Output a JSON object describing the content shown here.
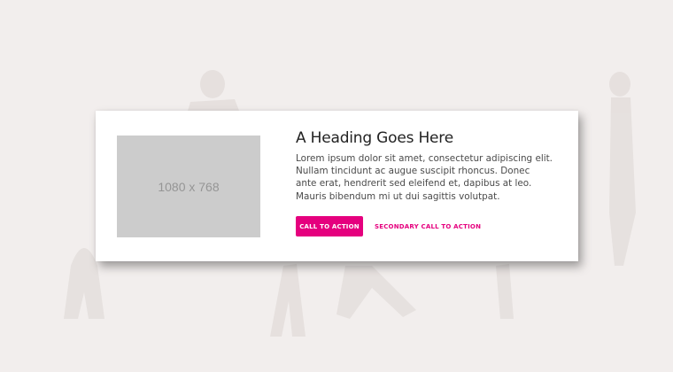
{
  "card": {
    "image_placeholder": "1080 x 768",
    "heading": "A Heading Goes Here",
    "body": "Lorem ipsum dolor sit amet, consectetur adipiscing elit. Nullam tincidunt ac augue suscipit rhoncus. Donec ante erat, hendrerit sed eleifend et, dapibus at leo. Mauris bibendum mi ut dui sagittis volutpat.",
    "primary_cta": "CALL TO ACTION",
    "secondary_cta": "SECONDARY CALL TO ACTION"
  },
  "colors": {
    "accent": "#e5007e",
    "background": "#f2eeed",
    "card": "#ffffff",
    "placeholder": "#cccccc"
  }
}
